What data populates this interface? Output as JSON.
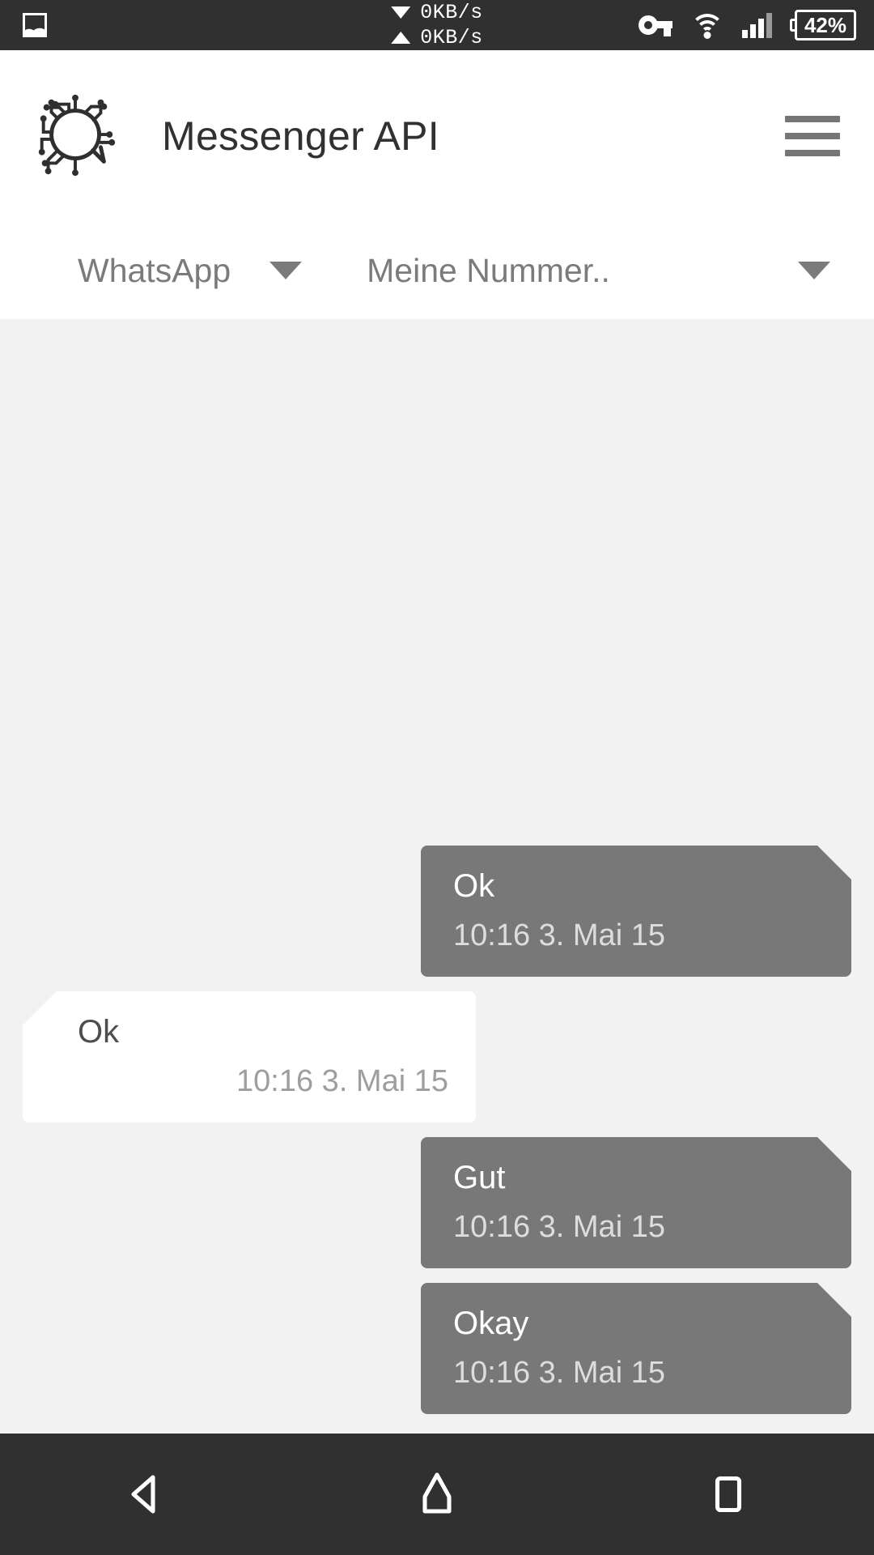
{
  "status_bar": {
    "left_icon": "photo-icon",
    "download_speed": "0KB/s",
    "upload_speed": "0KB/s",
    "icons": [
      "vpn-key-icon",
      "wifi-icon",
      "cellular-signal-icon"
    ],
    "battery_level": "42%",
    "background_color": "#303030"
  },
  "app_bar": {
    "logo_icon": "messenger-circuit-logo",
    "title": "Messenger API",
    "menu_icon": "hamburger-menu-icon",
    "background_color": "#ffffff",
    "title_color": "#313131"
  },
  "filters": {
    "messenger": {
      "label": "WhatsApp",
      "caret_icon": "chevron-down-icon"
    },
    "number": {
      "label": "Meine Nummer..",
      "caret_icon": "chevron-down-icon"
    },
    "text_color": "#7b7b7b"
  },
  "chat": {
    "background_color": "#f2f2f2",
    "outgoing_bubble_color": "#787878",
    "incoming_bubble_color": "#ffffff",
    "messages": [
      {
        "text": "Ok",
        "time": "10:16 3. Mai 15",
        "direction": "out"
      },
      {
        "text": "Ok",
        "time": "10:16 3. Mai 15",
        "direction": "in"
      },
      {
        "text": "Gut",
        "time": "10:16 3. Mai 15",
        "direction": "out"
      },
      {
        "text": "Okay",
        "time": "10:16 3. Mai 15",
        "direction": "out"
      }
    ]
  },
  "nav_bar": {
    "back_icon": "back-triangle-icon",
    "home_icon": "home-icon",
    "recents_icon": "recents-square-icon",
    "background_color": "#303030"
  }
}
